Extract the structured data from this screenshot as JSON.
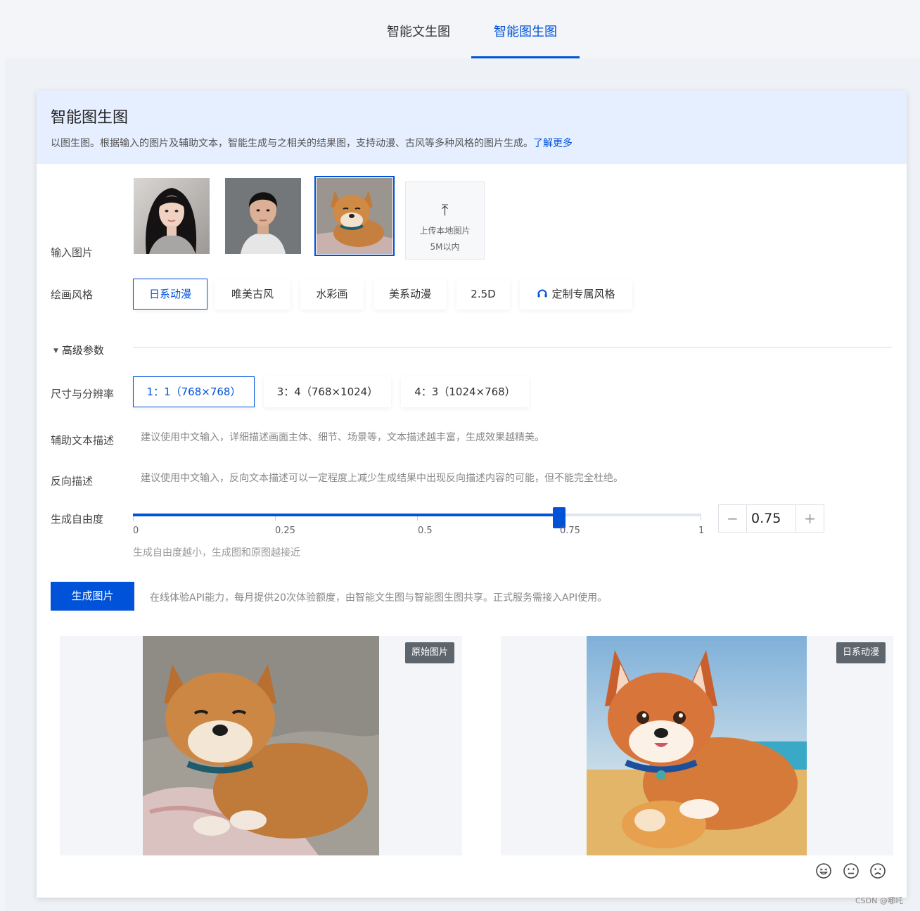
{
  "tabs": [
    {
      "label": "智能文生图",
      "active": false
    },
    {
      "label": "智能图生图",
      "active": true
    }
  ],
  "card": {
    "title": "智能图生图",
    "description": "以图生图。根据输入的图片及辅助文本，智能生成与之相关的结果图，支持动漫、古风等多种风格的图片生成。",
    "learn_more": "了解更多"
  },
  "input_images": {
    "label": "输入图片",
    "thumbnails": [
      "girl-portrait",
      "boy-portrait",
      "shiba-dog"
    ],
    "selected_index": 2,
    "upload": {
      "line1": "上传本地图片",
      "line2": "5M以内",
      "icon": "upload-icon"
    }
  },
  "style": {
    "label": "绘画风格",
    "options": [
      "日系动漫",
      "唯美古风",
      "水彩画",
      "美系动漫",
      "2.5D",
      "定制专属风格"
    ],
    "selected": "日系动漫",
    "custom_icon": "headset-icon"
  },
  "advanced": {
    "label": "高级参数",
    "icon": "caret-down-icon"
  },
  "size": {
    "label": "尺寸与分辨率",
    "options": [
      "1：1（768×768）",
      "3：4（768×1024）",
      "4：3（1024×768）"
    ],
    "selected": "1：1（768×768）"
  },
  "aux_text": {
    "label": "辅助文本描述",
    "value": "",
    "placeholder": "建议使用中文输入，详细描述画面主体、细节、场景等，文本描述越丰富，生成效果越精美。"
  },
  "neg_text": {
    "label": "反向描述",
    "value": "",
    "placeholder": "建议使用中文输入，反向文本描述可以一定程度上减少生成结果中出现反向描述内容的可能，但不能完全杜绝。"
  },
  "freedom": {
    "label": "生成自由度",
    "value": 0.75,
    "value_text": "0.75",
    "min": 0,
    "max": 1,
    "ticks": [
      "0",
      "0.25",
      "0.5",
      "0.75",
      "1"
    ],
    "hint": "生成自由度越小，生成图和原图越接近",
    "minus": "−",
    "plus": "+"
  },
  "generate": {
    "button": "生成图片",
    "note": "在线体验API能力，每月提供20次体验额度，由智能文生图与智能图生图共享。正式服务需接入API使用。"
  },
  "results": {
    "original_tag": "原始图片",
    "generated_tag": "日系动漫"
  },
  "feedback": [
    "happy-face-icon",
    "neutral-face-icon",
    "sad-face-icon"
  ],
  "colors": {
    "accent": "#0052d9",
    "header_bg": "#e6efff",
    "tag_bg": "#5f656d"
  },
  "watermark": "CSDN @哪吒"
}
